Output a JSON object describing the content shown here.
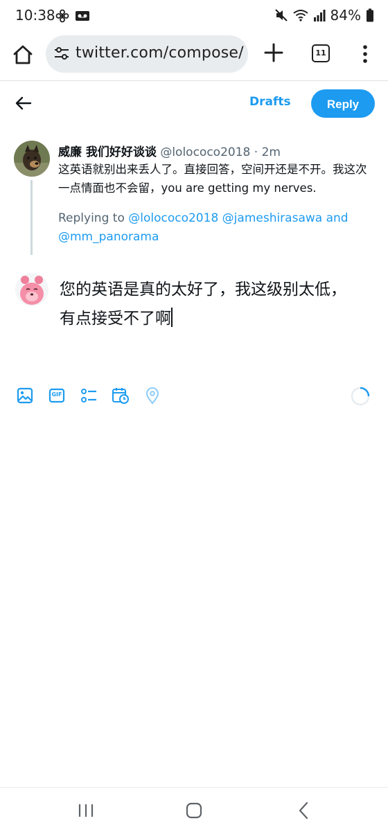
{
  "status_bar": {
    "time": "10:38",
    "battery": "84%",
    "icons": [
      "fan-icon",
      "voicemail-icon",
      "mute-icon",
      "wifi-icon",
      "signal-icon",
      "battery-icon"
    ]
  },
  "browser": {
    "url": "twitter.com/compose/",
    "tab_count": "11",
    "icons": [
      "home-icon",
      "tune-icon",
      "plus-icon",
      "menu-dots-icon"
    ]
  },
  "compose_header": {
    "drafts_label": "Drafts",
    "reply_label": "Reply",
    "back_icon": "arrow-left-icon"
  },
  "original_tweet": {
    "display_name": "威廉 我们好好谈谈",
    "handle": "@lolococo2018",
    "separator": "·",
    "time": "2m",
    "text": "这英语就别出来丢人了。直接回答，空间开还是不开。我这次一点情面也不会留，you are getting my nerves.",
    "replying_prefix": "Replying to",
    "mentions": [
      "@lolococo2018",
      "@jameshirasawa"
    ],
    "and_label": "and",
    "last_mention": "@mm_panorama"
  },
  "reply_draft": {
    "line1": "您的英语是真的太好了，我这级别太低，",
    "line2": "有点接受不了啊"
  },
  "toolbar": {
    "icons": [
      "image-icon",
      "gif-icon",
      "poll-icon",
      "schedule-icon",
      "location-icon",
      "char-count-ring-icon"
    ],
    "gif_label": "GIF"
  },
  "nav_bar": {
    "icons": [
      "recents-icon",
      "home-nav-icon",
      "back-nav-icon"
    ]
  },
  "colors": {
    "accent": "#1d9bf0",
    "text": "#0f1419",
    "secondary_text": "#536471"
  }
}
